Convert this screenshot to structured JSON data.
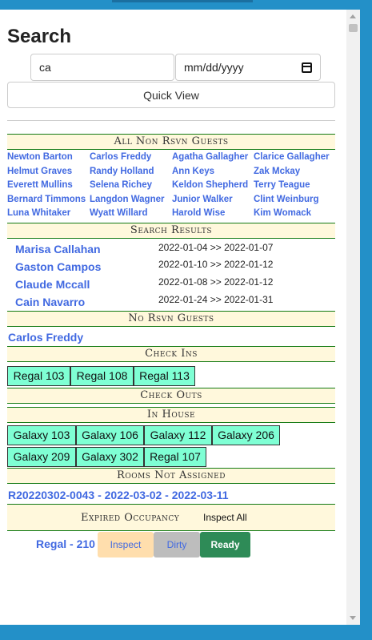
{
  "page": {
    "title": "Search"
  },
  "search": {
    "value": "ca",
    "date_placeholder": "mm/dd/yyyy",
    "quick_view_label": "Quick View"
  },
  "sections": {
    "all_non_rsvn": "All Non Rsvn Guests",
    "search_results": "Search Results",
    "no_rsvn": "No Rsvn Guests",
    "check_ins": "Check Ins",
    "check_outs": "Check Outs",
    "in_house": "In House",
    "rooms_not_assigned": "Rooms Not Assigned",
    "expired_occupancy": "Expired Occupancy"
  },
  "non_rsvn_guests": [
    "Newton Barton",
    "Carlos Freddy",
    "Agatha Gallagher",
    "Clarice Gallagher",
    "Helmut Graves",
    "Randy Holland",
    "Ann Keys",
    "Zak Mckay",
    "Everett Mullins",
    "Selena Richey",
    "Keldon Shepherd",
    "Terry Teague",
    "Bernard Timmons",
    "Langdon Wagner",
    "Junior Walker",
    "Clint Weinburg",
    "Luna Whitaker",
    "Wyatt Willard",
    "Harold Wise",
    "Kim Womack"
  ],
  "search_results": [
    {
      "name": "Marisa Callahan",
      "dates": "2022-01-04 >> 2022-01-07"
    },
    {
      "name": "Gaston Campos",
      "dates": "2022-01-10 >> 2022-01-12"
    },
    {
      "name": "Claude Mccall",
      "dates": "2022-01-08 >> 2022-01-12"
    },
    {
      "name": "Cain Navarro",
      "dates": "2022-01-24 >> 2022-01-31"
    }
  ],
  "no_rsvn_guests": [
    "Carlos Freddy"
  ],
  "check_ins": [
    "Regal 103",
    "Regal 108",
    "Regal 113"
  ],
  "in_house": [
    "Galaxy 103",
    "Galaxy 106",
    "Galaxy 112",
    "Galaxy 206",
    "Galaxy 209",
    "Galaxy 302",
    "Regal 107"
  ],
  "rooms_not_assigned": [
    "R20220302-0043 - 2022-03-02 - 2022-03-11"
  ],
  "expired": {
    "inspect_all_label": "Inspect All",
    "unit": "Regal - 210",
    "inspect_label": "Inspect",
    "dirty_label": "Dirty",
    "ready_label": "Ready"
  },
  "colors": {
    "link": "#4169e1",
    "room": "#7fffd4",
    "header_bg": "#fff8dc",
    "ready": "#2e8b57"
  }
}
